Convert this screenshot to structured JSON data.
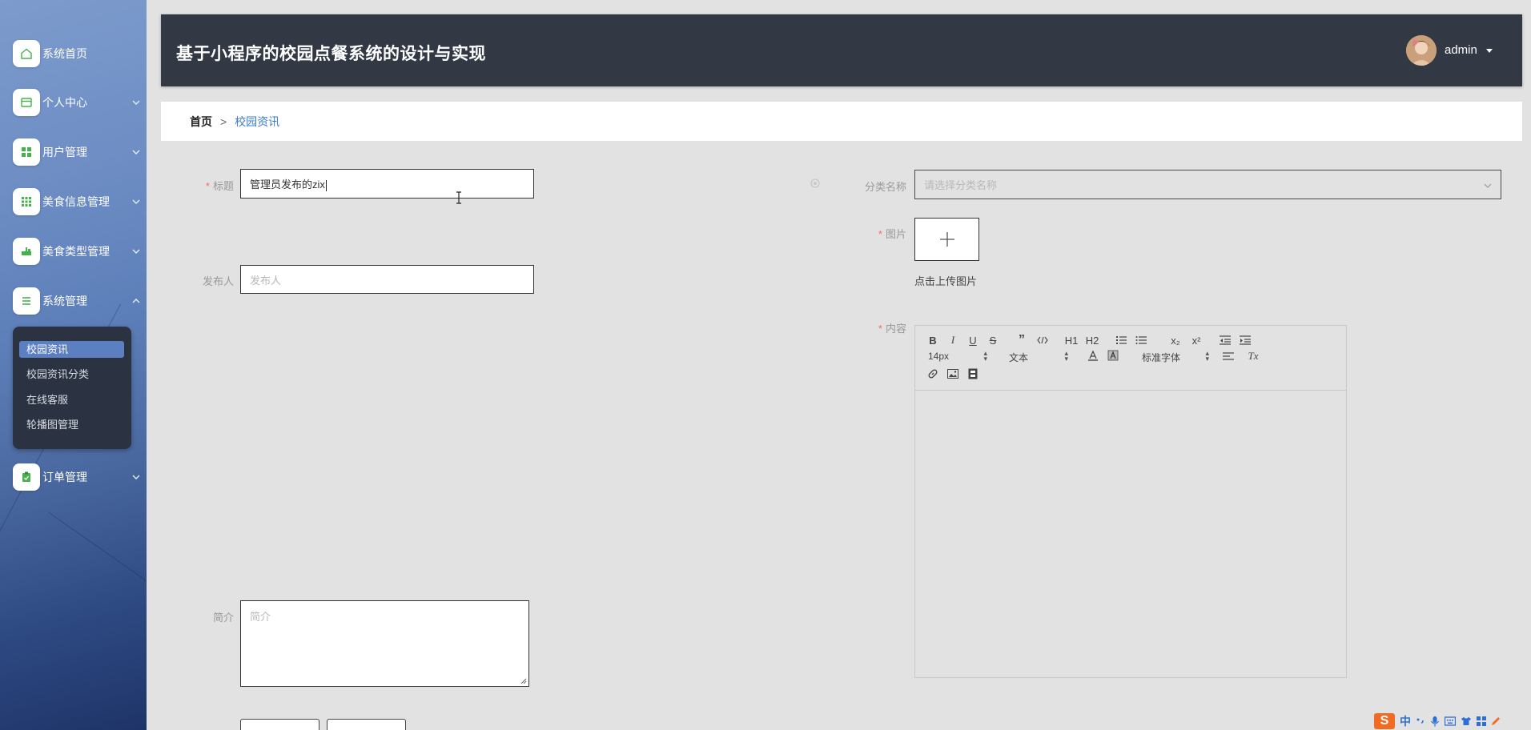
{
  "header": {
    "title": "基于小程序的校园点餐系统的设计与实现",
    "username": "admin"
  },
  "sidebar": {
    "items": [
      {
        "label": "系统首页",
        "icon": "home-icon"
      },
      {
        "label": "个人中心",
        "icon": "card-icon"
      },
      {
        "label": "用户管理",
        "icon": "grid-icon"
      },
      {
        "label": "美食信息管理",
        "icon": "apps-icon"
      },
      {
        "label": "美食类型管理",
        "icon": "food-icon"
      },
      {
        "label": "系统管理",
        "icon": "list-icon"
      },
      {
        "label": "订单管理",
        "icon": "clipboard-icon"
      }
    ],
    "submenu": [
      {
        "label": "校园资讯",
        "active": true
      },
      {
        "label": "校园资讯分类",
        "active": false
      },
      {
        "label": "在线客服",
        "active": false
      },
      {
        "label": "轮播图管理",
        "active": false
      }
    ]
  },
  "breadcrumb": {
    "home": "首页",
    "separator": ">",
    "current": "校园资讯"
  },
  "form": {
    "title_label": "标题",
    "title_value": "管理员发布的zix",
    "category_label": "分类名称",
    "category_placeholder": "请选择分类名称",
    "image_label": "图片",
    "upload_hint": "点击上传图片",
    "publisher_label": "发布人",
    "publisher_placeholder": "发布人",
    "content_label": "内容",
    "intro_label": "简介",
    "intro_placeholder": "简介",
    "required_mark": "*"
  },
  "editor": {
    "font_size": "14px",
    "heading_format": "文本",
    "font_family": "标准字体",
    "h1": "H1",
    "h2": "H2",
    "bold": "B",
    "italic": "I",
    "underline": "U",
    "strike": "S",
    "sub": "x₂",
    "sup": "x²",
    "clean": "Tx"
  },
  "ime": {
    "logo": "S",
    "lang": "中"
  },
  "colors": {
    "header_bg": "#323844",
    "sidebar_active": "#5b7fc0",
    "required": "#f56c6c",
    "breadcrumb_current": "#3a7cc4",
    "menu_icon_green": "#46b24c"
  }
}
